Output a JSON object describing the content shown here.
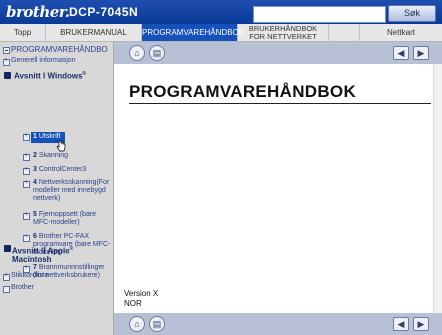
{
  "header": {
    "logo": "brother.",
    "model": "DCP-7045N",
    "search_button": "Søk",
    "search_value": ""
  },
  "tabs": [
    {
      "label": "Topp"
    },
    {
      "label": "BRUKERMANUAL"
    },
    {
      "label": "PROGRAMVAREHÅNDBOK",
      "active": true
    },
    {
      "label_line1": "BRUKERHÅNDBOK",
      "label_line2": "FOR NETTVERKET"
    },
    {
      "label": ""
    },
    {
      "label": "Nettkart"
    }
  ],
  "sidebar": {
    "top_item": "PROGRAMVAREHÅNDBO",
    "general": "Generell informasjon",
    "section1": "Avsnitt I Windows",
    "section1_sup": "®",
    "chapters": [
      {
        "num": "1",
        "label": "Utskrift"
      },
      {
        "num": "2",
        "label": "Skanning"
      },
      {
        "num": "3",
        "label": "ControlCenter3"
      },
      {
        "num": "4",
        "label": "Nettverksskanning(For modeller med innebygd nettverk)"
      },
      {
        "num": "5",
        "label": "Fjernoppsett (bare MFC-modeller)"
      },
      {
        "num": "6",
        "label": "Brother PC-FAX programvare (bare MFC-modeller)"
      },
      {
        "num": "7",
        "label": "Brannmurinnstillinger (for nettverksbrukere)"
      }
    ],
    "section2_line1": "Avsnitt II Apple",
    "section2_sup": "®",
    "section2_line2": "Macintosh",
    "index": "Stikkordliste",
    "brother": "Brother"
  },
  "content": {
    "title": "PROGRAMVAREHÅNDBOK",
    "version": "Version X",
    "lang": "NOR"
  },
  "colors": {
    "header_blue": "#0b3a96",
    "active_tab": "#1550bd",
    "sidebar_bg": "#d8d8d8",
    "navbar": "#b8c0d6"
  },
  "icons": [
    "home-icon",
    "book-icon",
    "prev-arrow-icon",
    "next-arrow-icon",
    "hand-cursor-icon"
  ]
}
